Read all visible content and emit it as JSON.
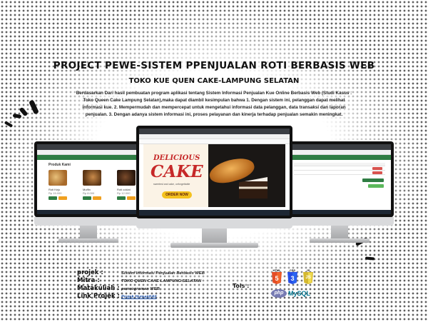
{
  "header": {
    "title": "PROJECT PEWE-SISTEM PPENJUALAN ROTI BERBASIS WEB",
    "subtitle": "TOKO KUE QUEN CAKE-LAMPUNG SELATAN",
    "description": "Berdasarkan Dari hasil pembuatan program aplikasi tentang Sistem Informasi Penjualan Kue Online Berbasis Web (Studi Kasus : Toko Queen Cake Lampung Selatan),maka dapat diambil kesimpulan bahwa 1. Dengan sistem ini, pelanggan dapat melihat informasi kue. 2. Mempermudah dan mempercepat untuk mengetahui informasi data pelanggan, data transaksi dan laporan penjualan. 3. Dengan adanya sistem informasi ini, proses pelayanan dan kinerja terhadap penjualan semakin meningkat."
  },
  "screens": {
    "center": {
      "banner_line1": "DELICIOUS",
      "banner_line2": "CAKE",
      "banner_tagline": "sweetest and cake, unforgettable",
      "order_button": "ORDER NOW"
    },
    "left": {
      "section_title": "Produk Kami",
      "products": [
        {
          "name": "Roti Keju",
          "price": "Rp 15.000"
        },
        {
          "name": "Muffin",
          "price": "Rp 8.000"
        },
        {
          "name": "Roti coklat",
          "price": "Rp 12.000"
        }
      ]
    }
  },
  "info": {
    "projek_label": "projek :",
    "projek_value": "Sistem Informasi Penjualan Berbasis WEB",
    "mitra_label": "Mitra :",
    "mitra_value": "TOKO QUEN CAKE LAMPUNG SELATAN",
    "matakuliah_label": "Matakuliah :",
    "matakuliah_value": "pemrograman WEB",
    "link_label": "Link Projek :",
    "link_value": "Projek HumaidiAli"
  },
  "tools": {
    "label": "Tols :",
    "html_label": "HTML",
    "html_num": "5",
    "css_label": "CSS",
    "css_num": "3",
    "js_label": "JS",
    "js_num": "JS",
    "php_label": "php",
    "mysql_label": "MySQL"
  },
  "colors": {
    "app_green": "#2f7d43",
    "banner_red": "#c62828",
    "order_yellow": "#f4c21f",
    "html_orange": "#e44d26",
    "css_blue": "#264de4",
    "js_yellow": "#f0db4f",
    "php_purple": "#777bb3"
  },
  "icons": [
    "decorative-stroke-icon",
    "html5-logo-icon",
    "css3-logo-icon",
    "js-logo-icon",
    "php-logo-icon",
    "mysql-logo-icon"
  ]
}
